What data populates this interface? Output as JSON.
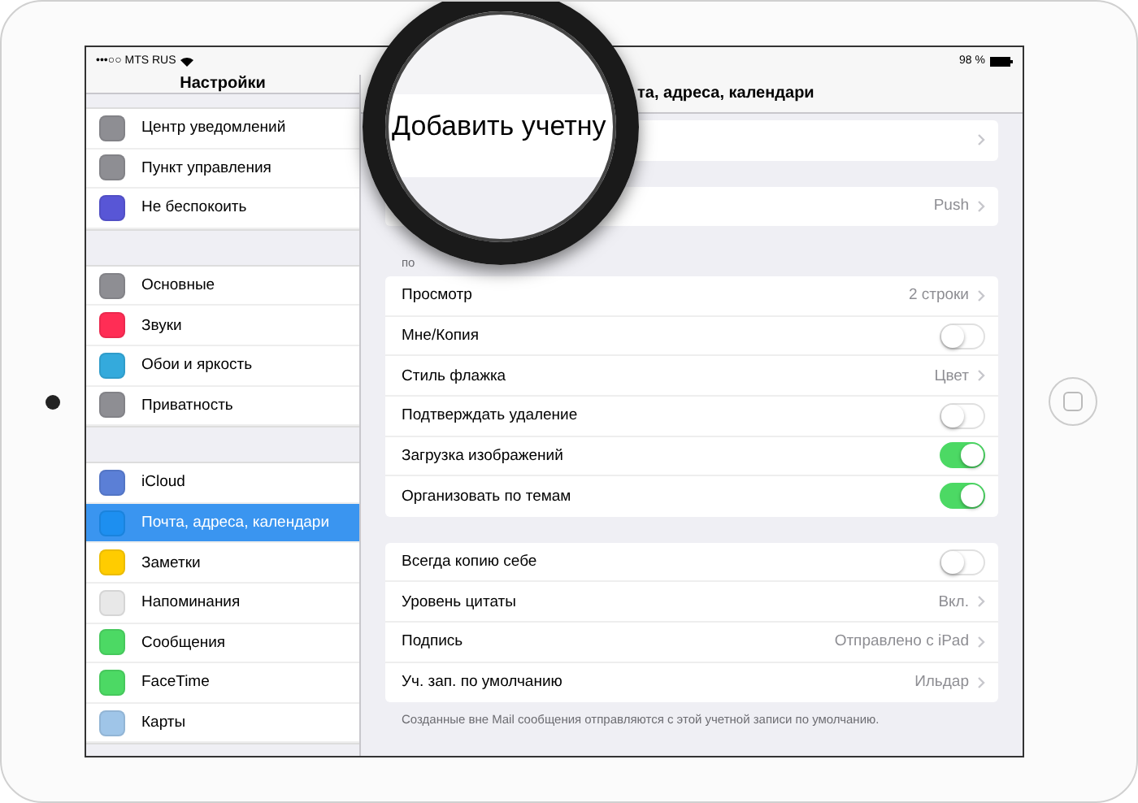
{
  "status_bar": {
    "carrier": "•••○○ MTS RUS",
    "battery": "98 %"
  },
  "sidebar": {
    "title": "Настройки",
    "groups": [
      [
        {
          "label": "Центр уведомлений",
          "color": "#8e8e93",
          "selected": false
        },
        {
          "label": "Пункт управления",
          "color": "#8e8e93",
          "selected": false
        },
        {
          "label": "Не беспокоить",
          "color": "#5856d6",
          "selected": false
        }
      ],
      [
        {
          "label": "Основные",
          "color": "#8e8e93",
          "selected": false
        },
        {
          "label": "Звуки",
          "color": "#ff2d55",
          "selected": false
        },
        {
          "label": "Обои и яркость",
          "color": "#34aadc",
          "selected": false
        },
        {
          "label": "Приватность",
          "color": "#8e8e93",
          "selected": false
        }
      ],
      [
        {
          "label": "iCloud",
          "color": "#5b7fd6",
          "selected": false
        },
        {
          "label": "Почта, адреса, календари",
          "color": "#1d8ff0",
          "selected": true
        },
        {
          "label": "Заметки",
          "color": "#ffcc00",
          "selected": false
        },
        {
          "label": "Напоминания",
          "color": "#e8e8e8",
          "selected": false
        },
        {
          "label": "Сообщения",
          "color": "#4cd964",
          "selected": false
        },
        {
          "label": "FaceTime",
          "color": "#4cd964",
          "selected": false
        },
        {
          "label": "Карты",
          "color": "#9fc5e8",
          "selected": false
        }
      ]
    ]
  },
  "detail": {
    "title": "та, адреса, календари",
    "magnifier_text": "Добавить учетну",
    "cards": [
      {
        "rows": [
          {
            "kind": "value",
            "label": "",
            "value": ""
          }
        ]
      },
      {
        "rows": [
          {
            "kind": "value",
            "label": "",
            "value": "Push"
          }
        ]
      },
      {
        "header": "по",
        "rows": [
          {
            "kind": "value",
            "label": "Просмотр",
            "value": "2 строки"
          },
          {
            "kind": "toggle",
            "label": "Мне/Копия",
            "on": false
          },
          {
            "kind": "value",
            "label": "Стиль флажка",
            "value": "Цвет"
          },
          {
            "kind": "toggle",
            "label": "Подтверждать удаление",
            "on": false
          },
          {
            "kind": "toggle",
            "label": "Загрузка изображений",
            "on": true
          },
          {
            "kind": "toggle",
            "label": "Организовать по темам",
            "on": true
          }
        ]
      },
      {
        "rows": [
          {
            "kind": "toggle",
            "label": "Всегда копию себе",
            "on": false
          },
          {
            "kind": "value",
            "label": "Уровень цитаты",
            "value": "Вкл."
          },
          {
            "kind": "value",
            "label": "Подпись",
            "value": "Отправлено с iPad"
          },
          {
            "kind": "value",
            "label": "Уч. зап. по умолчанию",
            "value": "Ильдар"
          }
        ],
        "footer": "Созданные вне Mail сообщения отправляются с этой учетной записи по умолчанию."
      }
    ]
  }
}
